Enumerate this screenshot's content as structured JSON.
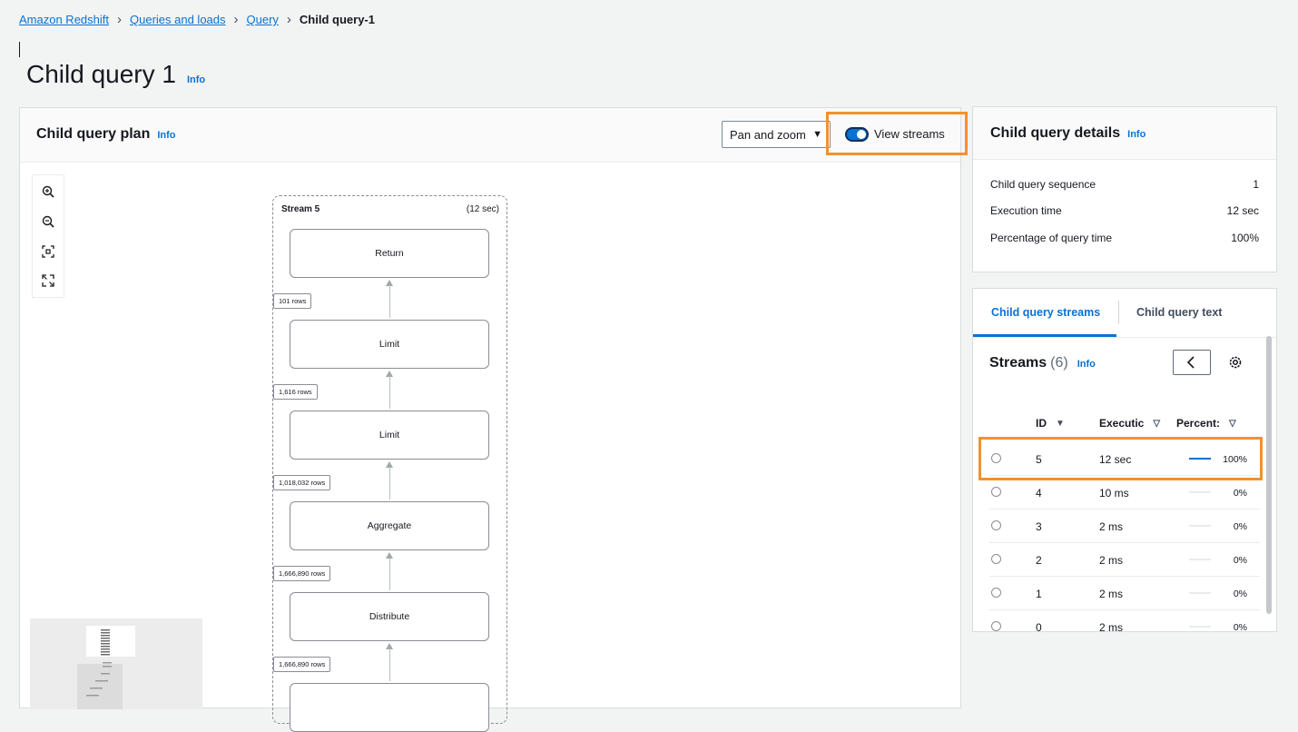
{
  "breadcrumb": {
    "items": [
      "Amazon Redshift",
      "Queries and loads",
      "Query"
    ],
    "current": "Child query-1"
  },
  "page": {
    "title": "Child query 1",
    "info": "Info"
  },
  "plan": {
    "title": "Child query plan",
    "info": "Info",
    "pan_select": "Pan and zoom",
    "view_streams_label": "View streams",
    "view_streams_on": true,
    "stream": {
      "name": "Stream 5",
      "time": "(12 sec)",
      "nodes": [
        "Return",
        "Limit",
        "Limit",
        "Aggregate",
        "Distribute"
      ],
      "edges": [
        "101 rows",
        "1,616 rows",
        "1,018,032 rows",
        "1,666,890 rows",
        "1,666,890 rows"
      ]
    }
  },
  "details": {
    "title": "Child query details",
    "info": "Info",
    "rows": [
      {
        "label": "Child query sequence",
        "value": "1"
      },
      {
        "label": "Execution time",
        "value": "12 sec"
      },
      {
        "label": "Percentage of query time",
        "value": "100%"
      }
    ]
  },
  "streams_panel": {
    "tabs": [
      "Child query streams",
      "Child query text"
    ],
    "heading": "Streams",
    "count": "(6)",
    "info": "Info",
    "columns": [
      "ID",
      "Executic",
      "Percent:"
    ],
    "rows": [
      {
        "id": "5",
        "exec": "12 sec",
        "pct": "100%",
        "fraction": 1.0
      },
      {
        "id": "4",
        "exec": "10 ms",
        "pct": "0%",
        "fraction": 0
      },
      {
        "id": "3",
        "exec": "2 ms",
        "pct": "0%",
        "fraction": 0
      },
      {
        "id": "2",
        "exec": "2 ms",
        "pct": "0%",
        "fraction": 0
      },
      {
        "id": "1",
        "exec": "2 ms",
        "pct": "0%",
        "fraction": 0
      },
      {
        "id": "0",
        "exec": "2 ms",
        "pct": "0%",
        "fraction": 0
      }
    ]
  },
  "colors": {
    "accent": "#0972d3",
    "highlight": "#f0922e"
  }
}
